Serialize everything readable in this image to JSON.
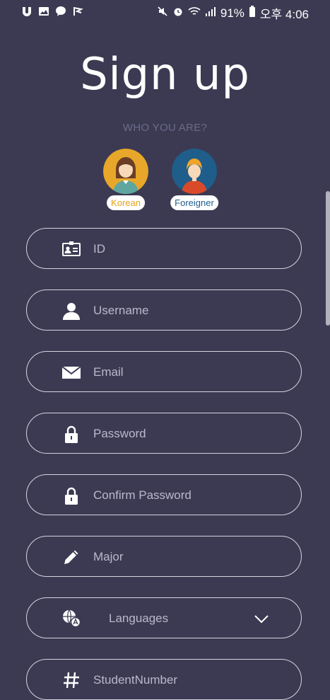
{
  "status_bar": {
    "battery": "91%",
    "time": "오후 4:06"
  },
  "header": {
    "title": "Sign up",
    "subtitle": "WHO YOU ARE?"
  },
  "user_types": [
    {
      "label": "Korean",
      "color": "#e4a21c"
    },
    {
      "label": "Foreigner",
      "color": "#1f5d8a"
    }
  ],
  "fields": [
    {
      "name": "id",
      "label": "ID",
      "icon": "id-card-icon"
    },
    {
      "name": "username",
      "label": "Username",
      "icon": "user-icon"
    },
    {
      "name": "email",
      "label": "Email",
      "icon": "envelope-icon"
    },
    {
      "name": "password",
      "label": "Password",
      "icon": "lock-icon"
    },
    {
      "name": "confirm_password",
      "label": "Confirm Password",
      "icon": "lock-icon"
    },
    {
      "name": "major",
      "label": "Major",
      "icon": "pencil-icon"
    },
    {
      "name": "languages",
      "label": "Languages",
      "icon": "globe-chat-icon"
    },
    {
      "name": "student_number",
      "label": "StudentNumber",
      "icon": "hash-icon"
    }
  ],
  "colors": {
    "background": "#3b3a52",
    "subtitle": "#6c6a8b",
    "field_border": "#d5d4e2",
    "placeholder": "#bab8cd"
  }
}
